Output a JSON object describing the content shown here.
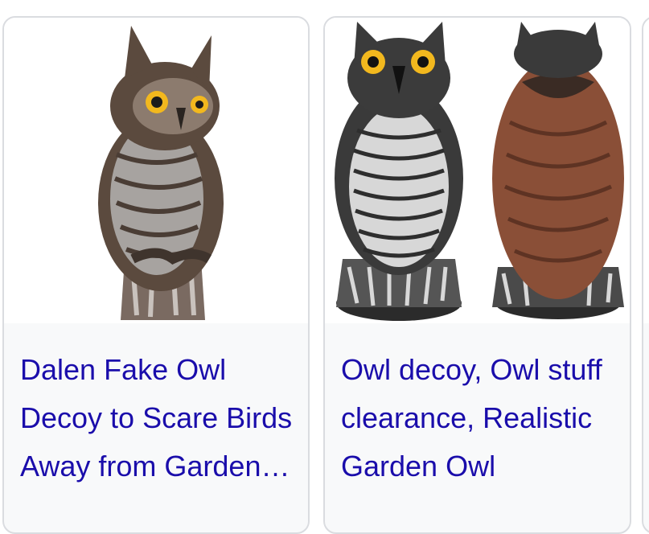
{
  "results": [
    {
      "title": "Dalen Fake Owl Decoy to Scare Birds Away from Garden and Yard"
    },
    {
      "title": "Owl decoy, Owl stuff clearance, Realistic Garden Owl"
    }
  ],
  "colors": {
    "link": "#1a0dab",
    "card_bg": "#f8f9fa",
    "card_border": "#dadce0",
    "owl_brown": "#5b4a3e",
    "owl_rust": "#8a4f37",
    "owl_eye": "#f2b81e"
  }
}
